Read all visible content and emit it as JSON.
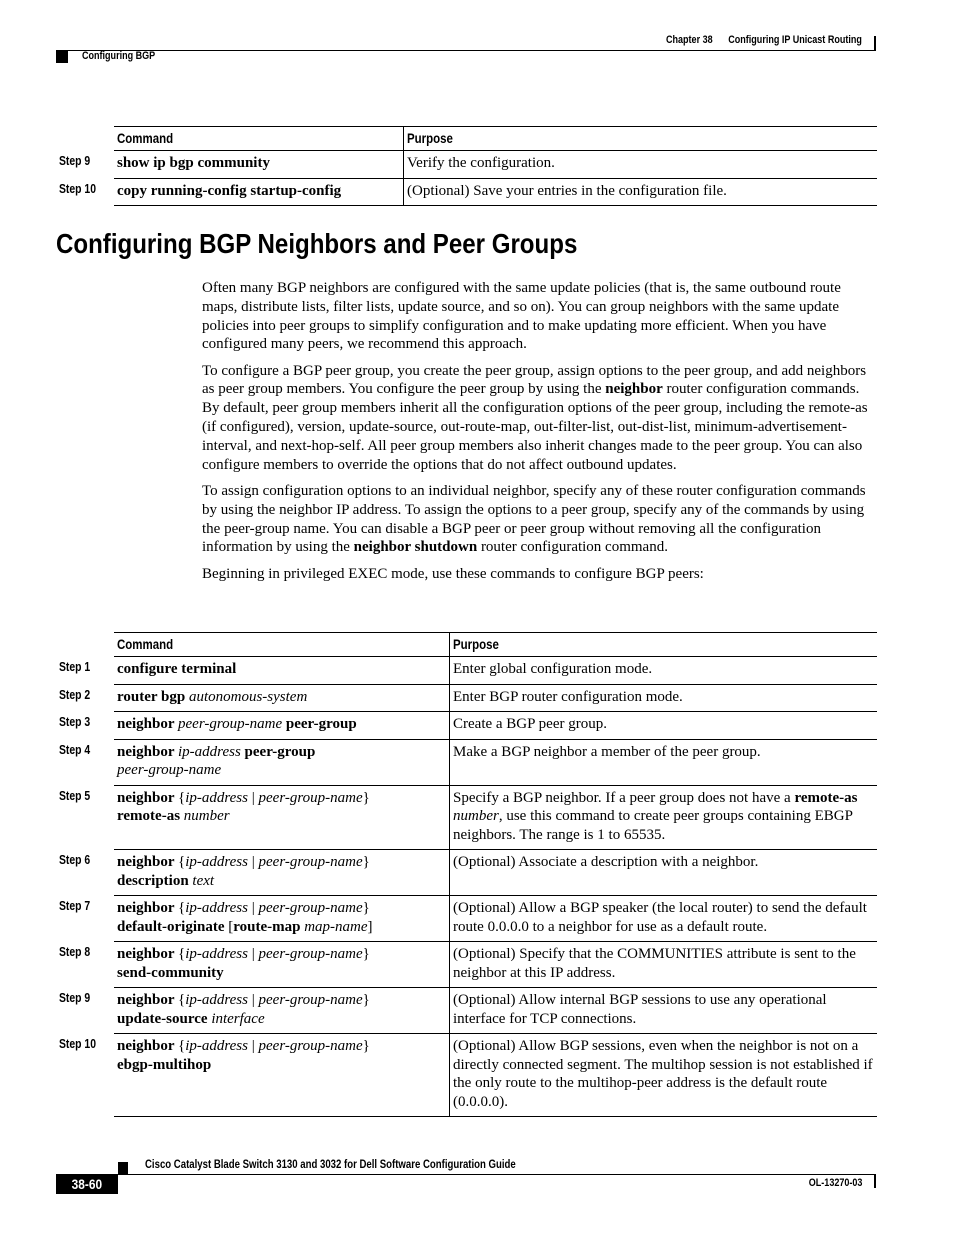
{
  "header": {
    "chapter": "Chapter 38",
    "chapter_title": "Configuring IP Unicast Routing",
    "section": "Configuring BGP"
  },
  "table_top": {
    "headers": [
      "Command",
      "Purpose"
    ],
    "rows": [
      {
        "step": "Step 9",
        "command": [
          {
            "t": "show ip bgp community",
            "s": "b"
          }
        ],
        "purpose": [
          {
            "t": "Verify the configuration.",
            "s": ""
          }
        ]
      },
      {
        "step": "Step 10",
        "command": [
          {
            "t": "copy running-config startup-config",
            "s": "b"
          }
        ],
        "purpose": [
          {
            "t": "(Optional) Save your entries in the configuration file.",
            "s": ""
          }
        ]
      }
    ]
  },
  "heading": "Configuring BGP Neighbors and Peer Groups",
  "paragraphs": [
    [
      {
        "t": "Often many BGP neighbors are configured with the same update policies (that is, the same outbound route maps, distribute lists, filter lists, update source, and so on). You can group neighbors with the same update policies into peer groups to simplify configuration and to make updating more efficient. When you have configured many peers, we recommend this approach.",
        "s": ""
      }
    ],
    [
      {
        "t": "To configure a BGP peer group, you create the peer group, assign options to the peer group, and add neighbors as peer group members. You configure the peer group by using the ",
        "s": ""
      },
      {
        "t": "neighbor",
        "s": "b"
      },
      {
        "t": " router configuration commands. By default, peer group members inherit all the configuration options of the peer group, including the remote-as (if configured), version, update-source, out-route-map, out-filter-list, out-dist-list, minimum-advertisement-interval, and next-hop-self. All peer group members also inherit changes made to the peer group. You can also configure members to override the options that do not affect outbound updates.",
        "s": ""
      }
    ],
    [
      {
        "t": "To assign configuration options to an individual neighbor, specify any of these router configuration commands by using the neighbor IP address. To assign the options to a peer group, specify any of the commands by using the peer-group name. You can disable a BGP peer or peer group without removing all the configuration information by using the ",
        "s": ""
      },
      {
        "t": "neighbor shutdown",
        "s": "b"
      },
      {
        "t": " router configuration command.",
        "s": ""
      }
    ],
    [
      {
        "t": "Beginning in privileged EXEC mode, use these commands to configure BGP peers:",
        "s": ""
      }
    ]
  ],
  "table_main": {
    "headers": [
      "Command",
      "Purpose"
    ],
    "rows": [
      {
        "step": "Step 1",
        "command": [
          {
            "t": "configure terminal",
            "s": "b"
          }
        ],
        "purpose": [
          {
            "t": "Enter global configuration mode.",
            "s": ""
          }
        ]
      },
      {
        "step": "Step 2",
        "command": [
          {
            "t": "router bgp ",
            "s": "b"
          },
          {
            "t": "autonomous-system",
            "s": "i"
          }
        ],
        "purpose": [
          {
            "t": "Enter BGP router configuration mode.",
            "s": ""
          }
        ]
      },
      {
        "step": "Step 3",
        "command": [
          {
            "t": "neighbor ",
            "s": "b"
          },
          {
            "t": "peer-group-name ",
            "s": "i"
          },
          {
            "t": "peer-group",
            "s": "b"
          }
        ],
        "purpose": [
          {
            "t": "Create a BGP peer group.",
            "s": ""
          }
        ]
      },
      {
        "step": "Step 4",
        "command": [
          {
            "t": "neighbor ",
            "s": "b"
          },
          {
            "t": "ip-address ",
            "s": "i"
          },
          {
            "t": "peer-group",
            "s": "b"
          },
          {
            "t": "",
            "s": "br"
          },
          {
            "t": "peer-group-name",
            "s": "i"
          }
        ],
        "purpose": [
          {
            "t": "Make a BGP neighbor a member of the peer group.",
            "s": ""
          }
        ]
      },
      {
        "step": "Step 5",
        "command": [
          {
            "t": "neighbor ",
            "s": "b"
          },
          {
            "t": "{",
            "s": ""
          },
          {
            "t": "ip-address",
            "s": "i"
          },
          {
            "t": " | ",
            "s": ""
          },
          {
            "t": "peer-group-name",
            "s": "i"
          },
          {
            "t": "}",
            "s": ""
          },
          {
            "t": "",
            "s": "br"
          },
          {
            "t": "remote-as ",
            "s": "b"
          },
          {
            "t": "number",
            "s": "i"
          }
        ],
        "purpose": [
          {
            "t": "Specify a BGP neighbor. If a peer group does not have a ",
            "s": ""
          },
          {
            "t": "remote-as ",
            "s": "b"
          },
          {
            "t": "number",
            "s": "i"
          },
          {
            "t": ", use this command to create peer groups containing EBGP neighbors. The range is 1 to 65535.",
            "s": ""
          }
        ]
      },
      {
        "step": "Step 6",
        "command": [
          {
            "t": "neighbor ",
            "s": "b"
          },
          {
            "t": "{",
            "s": ""
          },
          {
            "t": "ip-address",
            "s": "i"
          },
          {
            "t": " | ",
            "s": ""
          },
          {
            "t": "peer-group-name",
            "s": "i"
          },
          {
            "t": "}",
            "s": ""
          },
          {
            "t": "",
            "s": "br"
          },
          {
            "t": "description ",
            "s": "b"
          },
          {
            "t": "text",
            "s": "i"
          }
        ],
        "purpose": [
          {
            "t": "(Optional) Associate a description with a neighbor.",
            "s": ""
          }
        ]
      },
      {
        "step": "Step 7",
        "command": [
          {
            "t": "neighbor ",
            "s": "b"
          },
          {
            "t": "{",
            "s": ""
          },
          {
            "t": "ip-address",
            "s": "i"
          },
          {
            "t": " | ",
            "s": ""
          },
          {
            "t": "peer-group-name",
            "s": "i"
          },
          {
            "t": "}",
            "s": ""
          },
          {
            "t": "",
            "s": "br"
          },
          {
            "t": "default-originate ",
            "s": "b"
          },
          {
            "t": "[",
            "s": ""
          },
          {
            "t": "route-map ",
            "s": "b"
          },
          {
            "t": "map-name",
            "s": "i"
          },
          {
            "t": "]",
            "s": ""
          }
        ],
        "purpose": [
          {
            "t": "(Optional) Allow a BGP speaker (the local router) to send the default route 0.0.0.0 to a neighbor for use as a default route.",
            "s": ""
          }
        ]
      },
      {
        "step": "Step 8",
        "command": [
          {
            "t": "neighbor ",
            "s": "b"
          },
          {
            "t": "{",
            "s": ""
          },
          {
            "t": "ip-address",
            "s": "i"
          },
          {
            "t": " | ",
            "s": ""
          },
          {
            "t": "peer-group-name",
            "s": "i"
          },
          {
            "t": "}",
            "s": ""
          },
          {
            "t": "",
            "s": "br"
          },
          {
            "t": "send-community",
            "s": "b"
          }
        ],
        "purpose": [
          {
            "t": "(Optional) Specify that the COMMUNITIES attribute is sent to the neighbor at this IP address.",
            "s": ""
          }
        ]
      },
      {
        "step": "Step 9",
        "command": [
          {
            "t": "neighbor ",
            "s": "b"
          },
          {
            "t": "{",
            "s": ""
          },
          {
            "t": "ip-address",
            "s": "i"
          },
          {
            "t": " | ",
            "s": ""
          },
          {
            "t": "peer-group-name",
            "s": "i"
          },
          {
            "t": "}",
            "s": ""
          },
          {
            "t": "",
            "s": "br"
          },
          {
            "t": "update-source ",
            "s": "b"
          },
          {
            "t": "interface",
            "s": "i"
          }
        ],
        "purpose": [
          {
            "t": "(Optional) Allow internal BGP sessions to use any operational interface for TCP connections.",
            "s": ""
          }
        ]
      },
      {
        "step": "Step 10",
        "command": [
          {
            "t": "neighbor ",
            "s": "b"
          },
          {
            "t": "{",
            "s": ""
          },
          {
            "t": "ip-address",
            "s": "i"
          },
          {
            "t": " | ",
            "s": ""
          },
          {
            "t": "peer-group-name",
            "s": "i"
          },
          {
            "t": "}",
            "s": ""
          },
          {
            "t": "",
            "s": "br"
          },
          {
            "t": "ebgp-multihop",
            "s": "b"
          }
        ],
        "purpose": [
          {
            "t": "(Optional) Allow BGP sessions, even when the neighbor is not on a directly connected segment. The multihop session is not established if the only route to the multihop-peer address is the default route (0.0.0.0).",
            "s": ""
          }
        ]
      }
    ]
  },
  "footer": {
    "guide_title": "Cisco Catalyst Blade Switch 3130 and 3032 for Dell Software Configuration Guide",
    "page_number": "38-60",
    "doc_id": "OL-13270-03"
  }
}
